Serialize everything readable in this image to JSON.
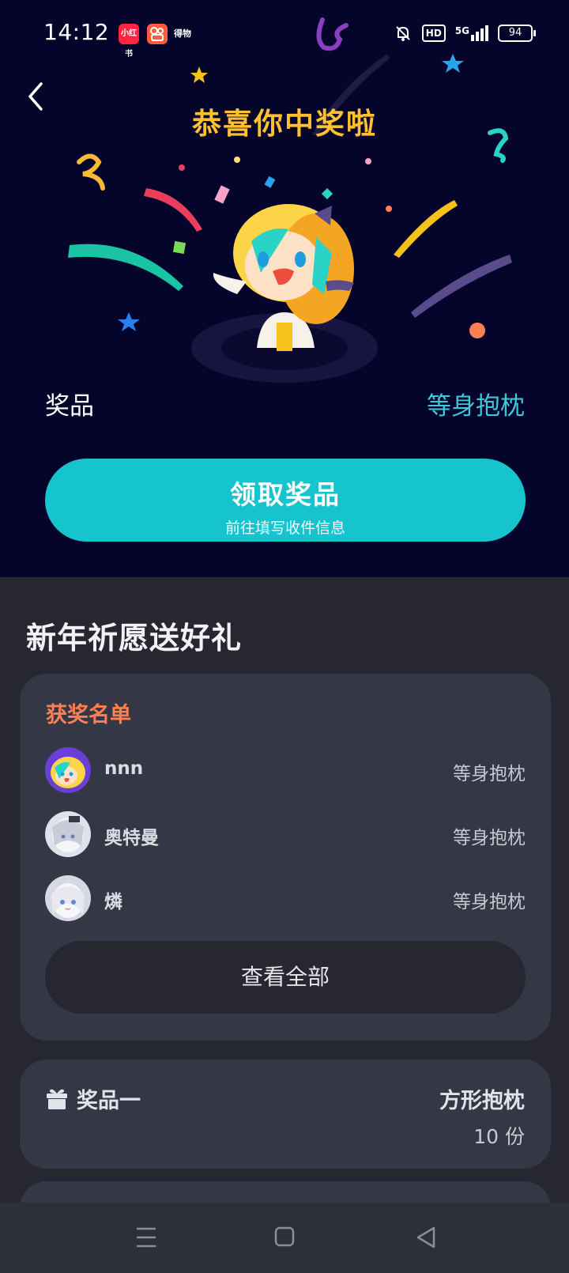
{
  "status_bar": {
    "time": "14:12",
    "app_badges": [
      "小红书",
      "",
      "得物"
    ],
    "hd_label": "HD",
    "network_label": "5G",
    "battery": "94"
  },
  "header": {
    "title": "恭喜你中奖啦"
  },
  "prize": {
    "label": "奖品",
    "value": "等身抱枕"
  },
  "claim_button": {
    "title": "领取奖品",
    "subtitle": "前往填写收件信息"
  },
  "section": {
    "title": "新年祈愿送好礼"
  },
  "winners": {
    "title": "获奖名单",
    "rows": [
      {
        "name": "nnn",
        "prize": "等身抱枕"
      },
      {
        "name": "奥特曼",
        "prize": "等身抱枕"
      },
      {
        "name": "燐",
        "prize": "等身抱枕"
      }
    ],
    "view_all_label": "查看全部"
  },
  "prize_item": {
    "label": "奖品一",
    "name": "方形抱枕",
    "count": "10 份"
  },
  "colors": {
    "accent_teal": "#16c4cd",
    "headline_gold": "#fdc02e",
    "winners_title_orange": "#ff7f52",
    "top_background": "#05042a",
    "page_background": "#262730"
  }
}
